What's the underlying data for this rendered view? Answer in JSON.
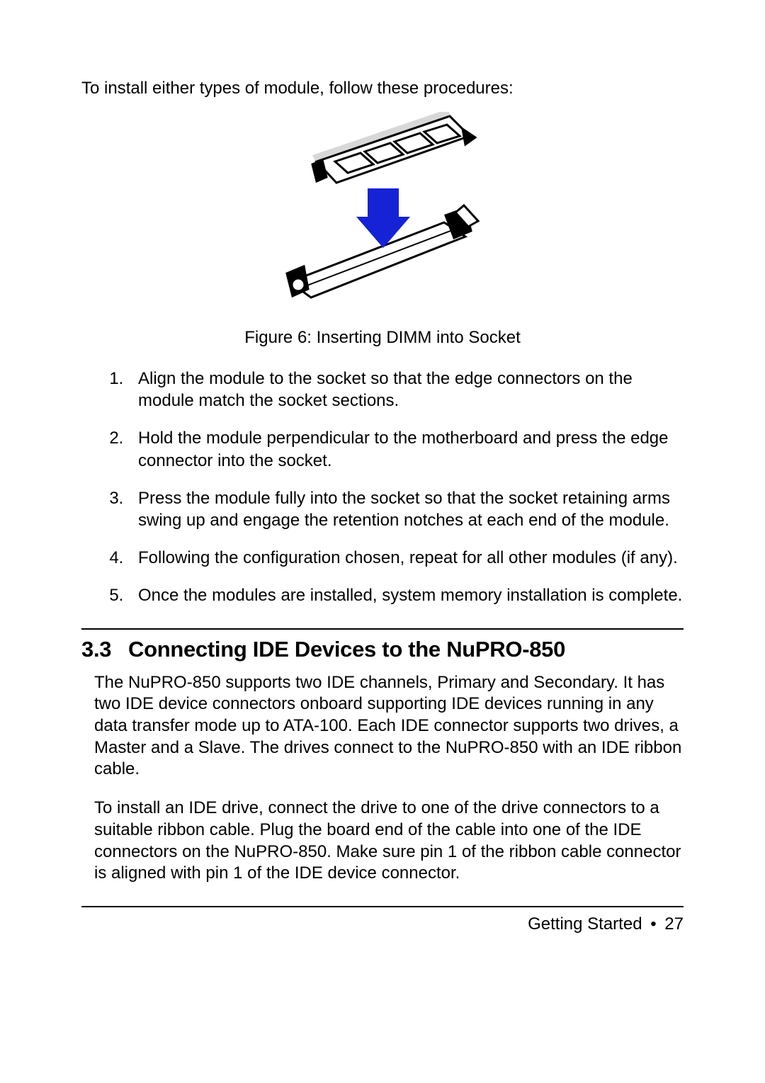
{
  "intro": "To install either types of module, follow these procedures:",
  "figure_caption": "Figure 6: Inserting DIMM into Socket",
  "steps": [
    "Align the module to the socket so that the edge connectors on the module match the socket sections.",
    "Hold the module perpendicular to the motherboard and press the edge connector into the socket.",
    "Press the module fully into the socket so that the socket retaining arms swing up and engage the retention notches at each end of the module.",
    "Following the configuration chosen, repeat for all other modules (if any).",
    "Once the modules are installed, system memory installation is complete."
  ],
  "section": {
    "number": "3.3",
    "title": "Connecting IDE Devices to the NuPRO-850"
  },
  "para1": "The NuPRO-850 supports two IDE channels, Primary and Secondary. It has two IDE device connectors onboard supporting IDE devices running in any data transfer mode up to ATA-100. Each IDE connector supports two drives, a Master and a Slave. The drives connect to the NuPRO-850 with an IDE ribbon cable.",
  "para2": "To install an IDE drive, connect the drive to one of the drive connectors to a suitable ribbon cable. Plug the board end of the cable into one of the IDE connectors on the NuPRO-850.  Make sure pin 1 of the ribbon cable connector is aligned with pin 1 of the IDE device connector.",
  "footer": {
    "chapter": "Getting Started",
    "page": "27"
  }
}
